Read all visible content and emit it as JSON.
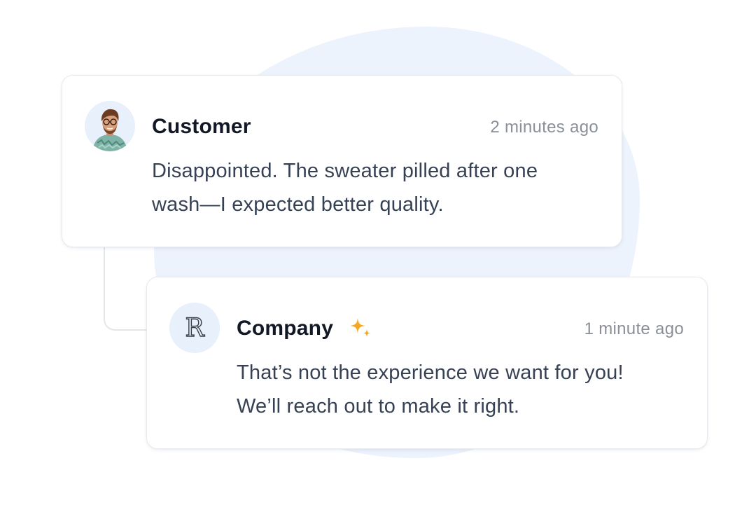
{
  "colors": {
    "background_blob": "#ecf3fd",
    "card_border": "#e6e9ee",
    "name_text": "#121826",
    "message_text": "#364154",
    "time_text": "#8a8f98",
    "sparkle": "#f5a623",
    "connector": "#e3e7ec"
  },
  "customer": {
    "name": "Customer",
    "time": "2 minutes ago",
    "message": "Disappointed. The sweater pilled after one wash—I expected better quality.",
    "avatar_icon": "person-photo-avatar"
  },
  "company": {
    "name": "Company",
    "time": "1 minute ago",
    "message": "That’s not the experience we want for you! We’ll reach out to make it right.",
    "logo_letter": "R",
    "badge_icon": "sparkle-icon"
  }
}
